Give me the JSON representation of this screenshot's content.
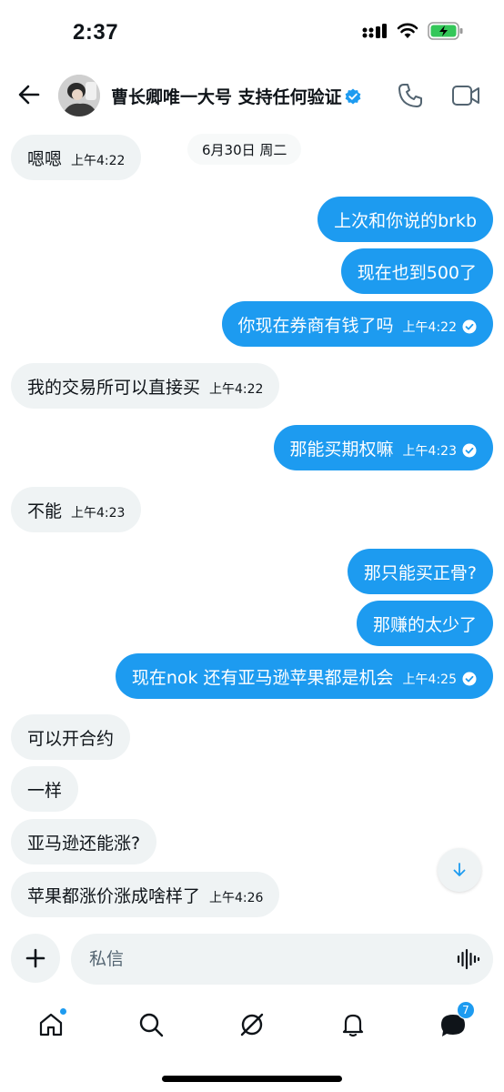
{
  "status_bar": {
    "time": "2:37"
  },
  "header": {
    "contact_name": "曹长卿唯一大号 支持任何验证"
  },
  "date_separator": "6月30日 周二",
  "messages": [
    {
      "text": "嗯嗯",
      "time": "上午4:22"
    },
    {
      "text": "上次和你说的brkb"
    },
    {
      "text": "现在也到500了"
    },
    {
      "text": "你现在券商有钱了吗",
      "time": "上午4:22"
    },
    {
      "text": "我的交易所可以直接买",
      "time": "上午4:22"
    },
    {
      "text": "那能买期权嘛",
      "time": "上午4:23"
    },
    {
      "text": "不能",
      "time": "上午4:23"
    },
    {
      "text": "那只能买正骨?"
    },
    {
      "text": "那赚的太少了"
    },
    {
      "text": "现在nok 还有亚马逊苹果都是机会",
      "time": "上午4:25"
    },
    {
      "text": "可以开合约"
    },
    {
      "text": "一样"
    },
    {
      "text": "亚马逊还能涨?"
    },
    {
      "text": "苹果都涨价涨成啥样了",
      "time": "上午4:26"
    }
  ],
  "composer": {
    "placeholder": "私信"
  },
  "nav": {
    "messages_badge": "7"
  },
  "colors": {
    "accent": "#1d9bf0",
    "incoming_bubble": "#eff3f4",
    "battery": "#34c759"
  }
}
